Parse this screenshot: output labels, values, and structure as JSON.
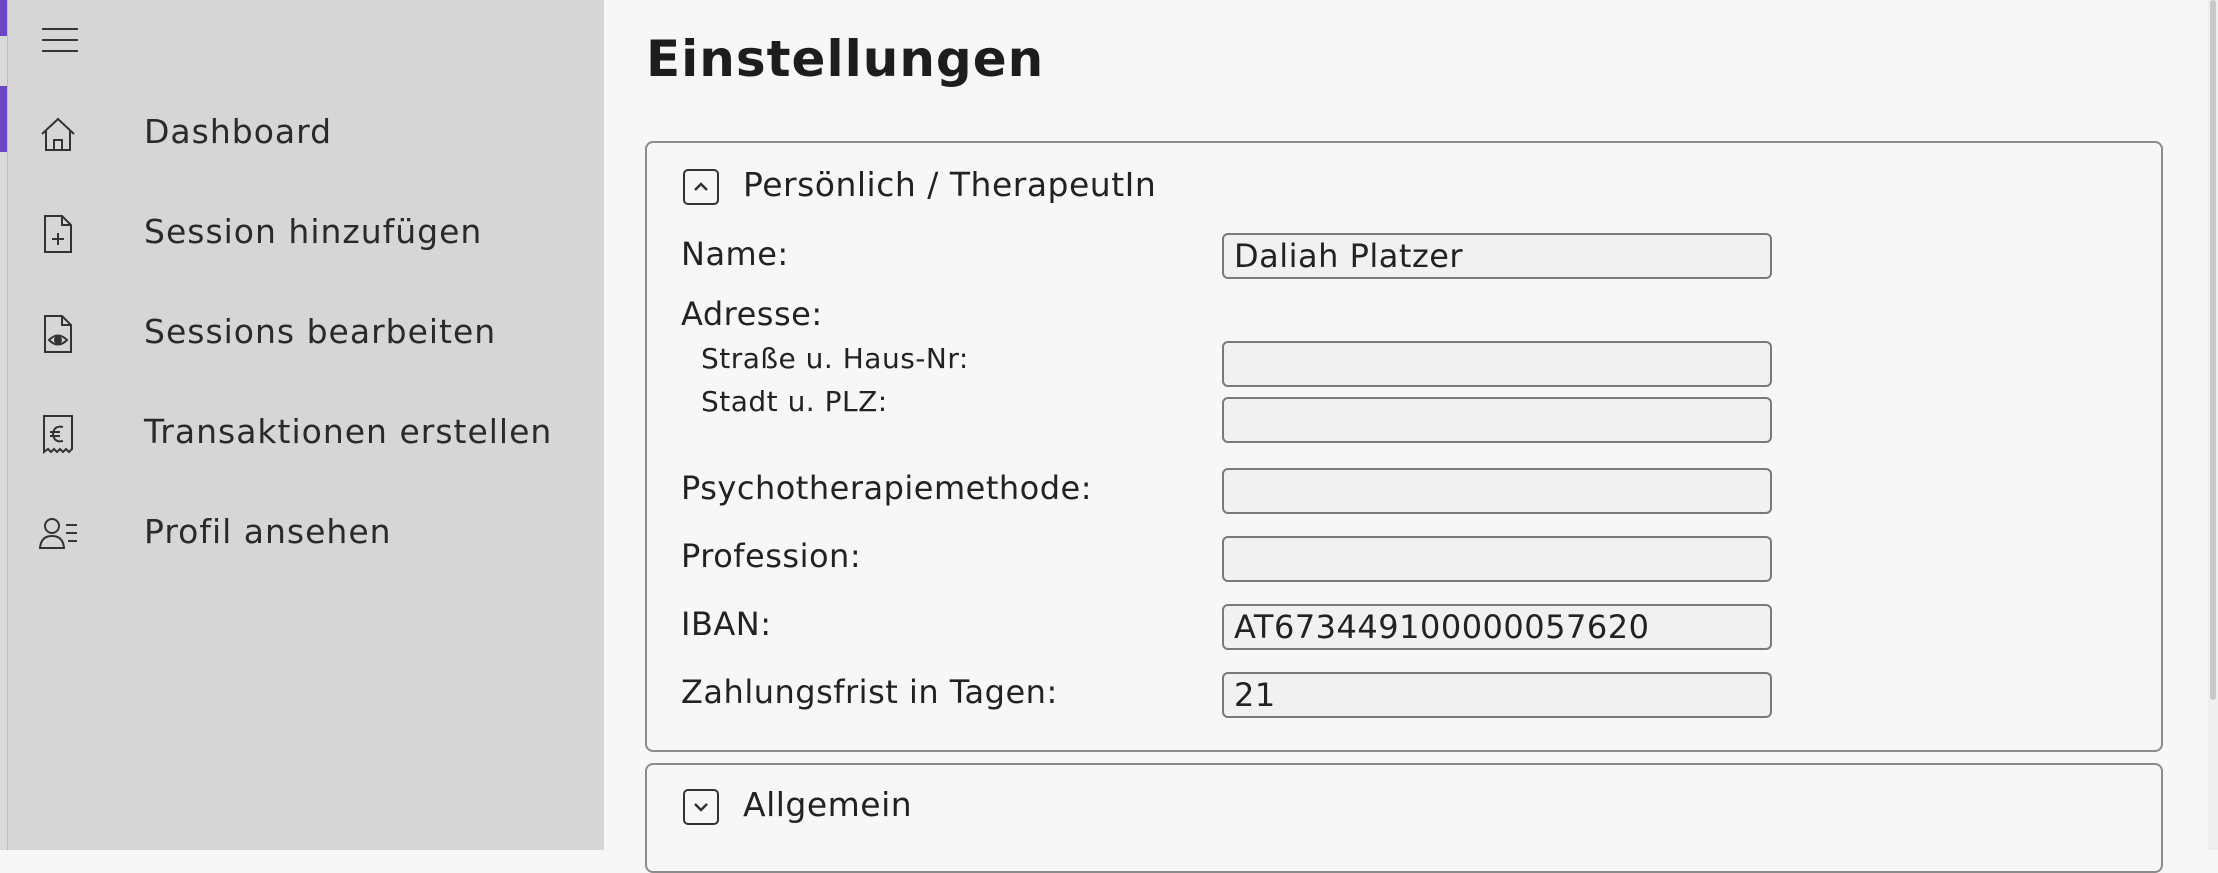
{
  "sidebar": {
    "menu_icon": "hamburger-icon",
    "items": [
      {
        "label": "Dashboard",
        "icon": "home-icon"
      },
      {
        "label": "Session hinzufügen",
        "icon": "file-add-icon"
      },
      {
        "label": "Sessions bearbeiten",
        "icon": "file-view-icon"
      },
      {
        "label": "Transaktionen erstellen",
        "icon": "euro-receipt-icon"
      },
      {
        "label": "Profil ansehen",
        "icon": "profile-list-icon"
      }
    ]
  },
  "main": {
    "title": "Einstellungen",
    "personal": {
      "title": "Persönlich / TherapeutIn",
      "toggle_icon": "chevron-up-icon",
      "name_label": "Name:",
      "name_value": "Daliah Platzer",
      "address_label": "Adresse:",
      "street_label": "Straße u. Haus-Nr:",
      "street_value": "",
      "city_label": "Stadt u. PLZ:",
      "city_value": "",
      "method_label": "Psychotherapiemethode:",
      "method_value": "",
      "profession_label": "Profession:",
      "profession_value": "",
      "iban_label": "IBAN:",
      "iban_value": "AT673449100000057620",
      "deadline_label": "Zahlungsfrist in Tagen:",
      "deadline_value": "21"
    },
    "general": {
      "title": "Allgemein",
      "toggle_icon": "chevron-down-icon"
    }
  }
}
